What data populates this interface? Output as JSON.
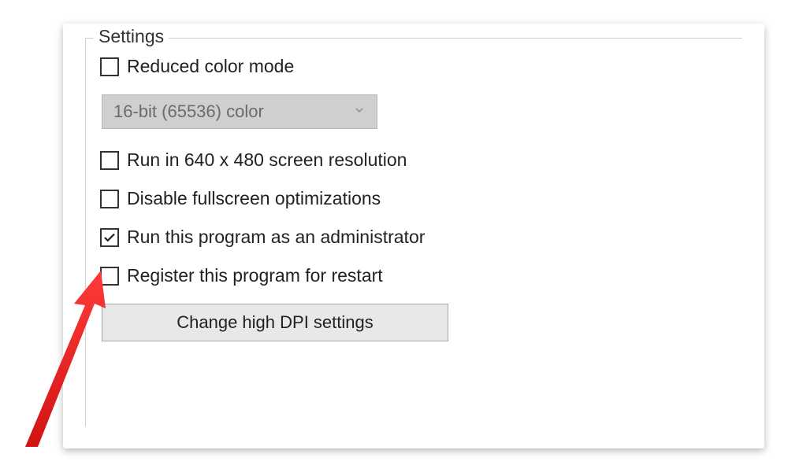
{
  "group": {
    "legend": "Settings"
  },
  "options": {
    "reduced_color": {
      "label": "Reduced color mode",
      "checked": false
    },
    "color_depth_selected": "16-bit (65536) color",
    "run_640x480": {
      "label": "Run in 640 x 480 screen resolution",
      "checked": false
    },
    "disable_fullscreen": {
      "label": "Disable fullscreen optimizations",
      "checked": false
    },
    "run_as_admin": {
      "label": "Run this program as an administrator",
      "checked": true
    },
    "register_restart": {
      "label": "Register this program for restart",
      "checked": false
    }
  },
  "buttons": {
    "change_dpi": "Change high DPI settings"
  },
  "annotation": {
    "arrow_color": "#e11b1b"
  }
}
